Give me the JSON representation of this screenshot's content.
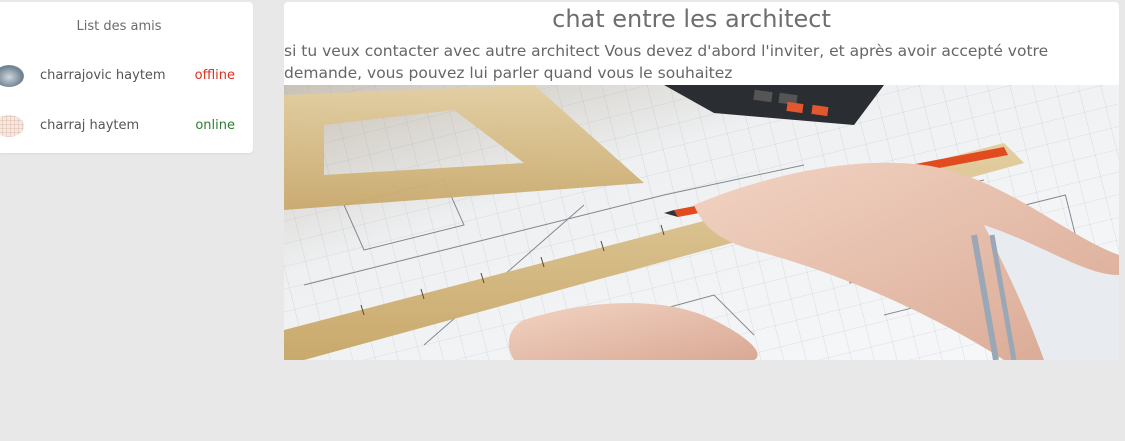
{
  "sidebar": {
    "title": "List des amis",
    "friends": [
      {
        "name": "charrajovic haytem",
        "status": "offline"
      },
      {
        "name": "charraj haytem",
        "status": "online"
      }
    ]
  },
  "main": {
    "title": "chat entre les architect",
    "description": "si tu veux contacter avec autre architect Vous devez d'abord l'inviter, et après avoir accepté votre demande, vous pouvez lui parler quand vous le souhaitez"
  },
  "colors": {
    "page_background": "#e8e8e8",
    "offline": "#e0301e",
    "online": "#2e7d32"
  },
  "icons": {
    "hero": "architect-drawing-blueprint-image"
  }
}
